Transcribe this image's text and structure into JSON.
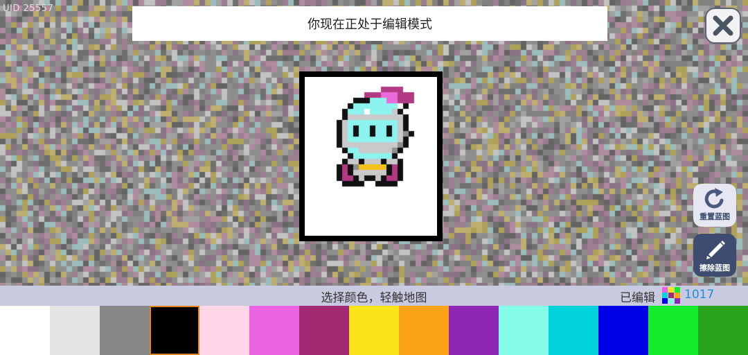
{
  "uid_label": "UID 25557",
  "mode_banner": "你现在正处于编辑模式",
  "close_icon": "close-x-icon",
  "side_buttons": {
    "reset": {
      "label": "重置蓝图",
      "icon": "redo-icon"
    },
    "erase": {
      "label": "擦除蓝图",
      "icon": "pencil-icon"
    }
  },
  "status": {
    "prompt": "选择颜色，轻触地图",
    "edited_label": "已编辑",
    "edited_count": "1017"
  },
  "palette": {
    "selected_index": 3,
    "colors": [
      "#ffffff",
      "#e4e4e4",
      "#888888",
      "#000000",
      "#ffd6e8",
      "#eb62e3",
      "#a12a72",
      "#fbe51a",
      "#fba216",
      "#8e27b1",
      "#83fbe8",
      "#00d3db",
      "#0000e8",
      "#15ec2c",
      "#2aa31c"
    ]
  }
}
